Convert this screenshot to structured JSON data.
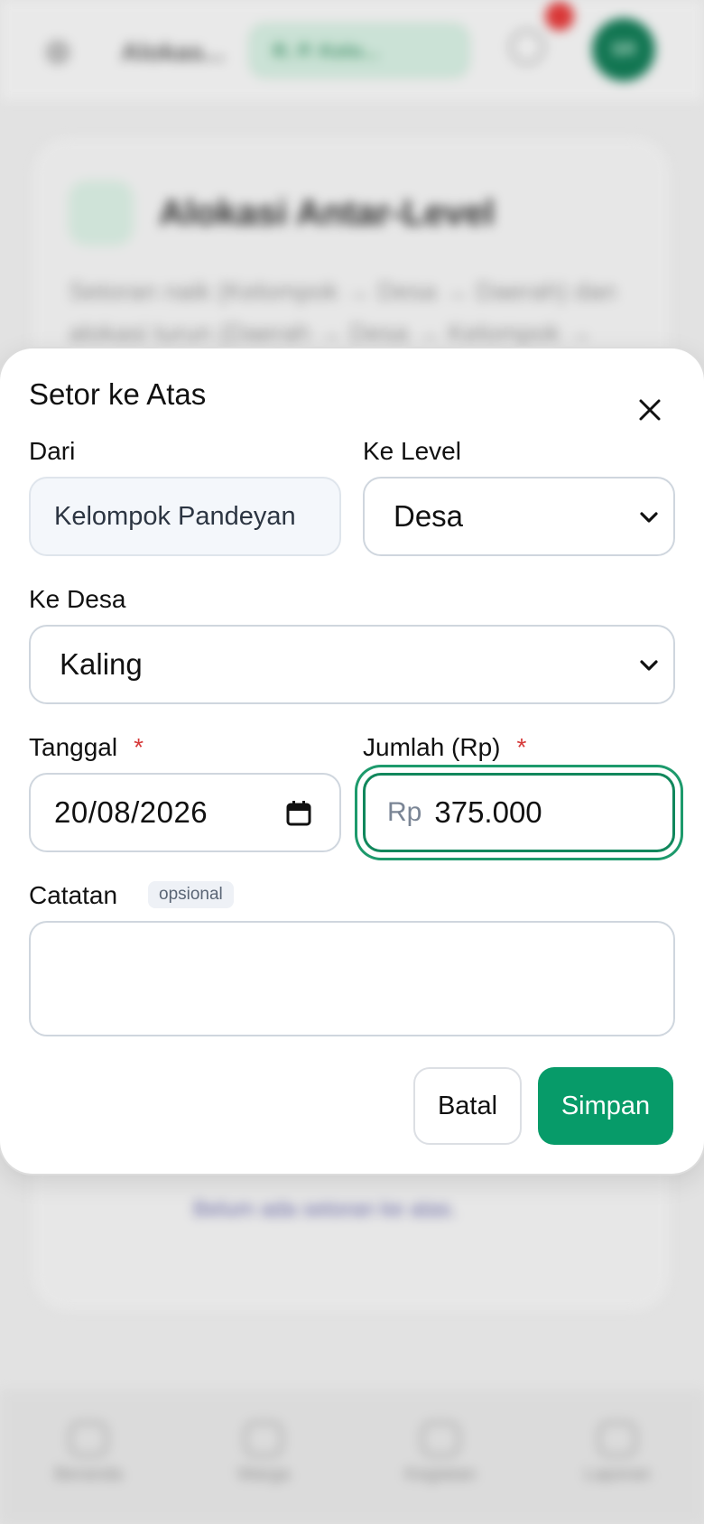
{
  "background": {
    "app_title": "Alokas...",
    "chip_label": "R. P. Kelo...",
    "avatar_initials": "SR",
    "card_title": "Alokasi Antar-Level",
    "card_description": "Setoran naik (Kelompok → Desa → Daerah) dan alokasi turun (Daerah → Desa → Kelompok →",
    "empty_message": "Belum ada setoran ke atas.",
    "nav": [
      {
        "label": "Beranda"
      },
      {
        "label": "Warga"
      },
      {
        "label": "Kegiatan"
      },
      {
        "label": "Laporan"
      }
    ]
  },
  "modal": {
    "title": "Setor ke Atas",
    "from_label": "Dari",
    "from_value": "Kelompok Pandeyan",
    "to_level_label": "Ke Level",
    "to_level_value": "Desa",
    "to_desa_label": "Ke Desa",
    "to_desa_value": "Kaling",
    "date_label": "Tanggal",
    "date_value": "20/08/2026",
    "amount_label": "Jumlah (Rp)",
    "amount_prefix": "Rp",
    "amount_value": "375.000",
    "required_mark": "*",
    "note_label": "Catatan",
    "note_badge": "opsional",
    "note_value": "",
    "cancel_label": "Batal",
    "save_label": "Simpan"
  },
  "colors": {
    "primary": "#079b69",
    "focus_ring": "#1d9a6c",
    "required": "#d63a3a",
    "notification": "#e23a3a"
  }
}
